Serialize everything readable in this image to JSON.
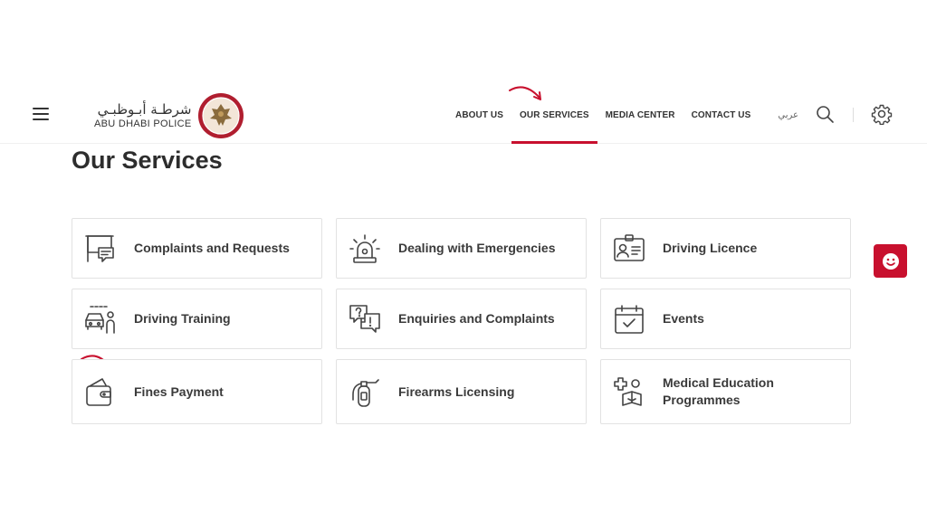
{
  "header": {
    "logo_ar": "شرطـة أبـوظبـي",
    "logo_en": "ABU DHABI POLICE",
    "nav": [
      {
        "label": "ABOUT US",
        "active": false
      },
      {
        "label": "OUR SERVICES",
        "active": true
      },
      {
        "label": "MEDIA CENTER",
        "active": false
      },
      {
        "label": "CONTACT US",
        "active": false
      }
    ],
    "language": "عربي",
    "icons": {
      "menu": "hamburger-icon",
      "search": "search-icon",
      "settings": "gear-icon"
    }
  },
  "page": {
    "title": "Our Services"
  },
  "services": [
    {
      "label": "Complaints and Requests",
      "icon": "complaint-board-icon"
    },
    {
      "label": "Dealing with Emergencies",
      "icon": "emergency-siren-icon"
    },
    {
      "label": "Driving Licence",
      "icon": "id-card-icon"
    },
    {
      "label": "Driving Training",
      "icon": "car-instructor-icon"
    },
    {
      "label": "Enquiries and Complaints",
      "icon": "question-chat-icon"
    },
    {
      "label": "Events",
      "icon": "calendar-icon"
    },
    {
      "label": "Fines Payment",
      "icon": "wallet-icon"
    },
    {
      "label": "Firearms Licensing",
      "icon": "fire-extinguisher-icon"
    },
    {
      "label": "Medical Education Programmes",
      "icon": "medical-education-icon"
    }
  ],
  "chat": {
    "icon": "smiley-icon"
  },
  "colors": {
    "accent": "#c8102e",
    "text": "#333333",
    "border": "#e2e2e2"
  }
}
